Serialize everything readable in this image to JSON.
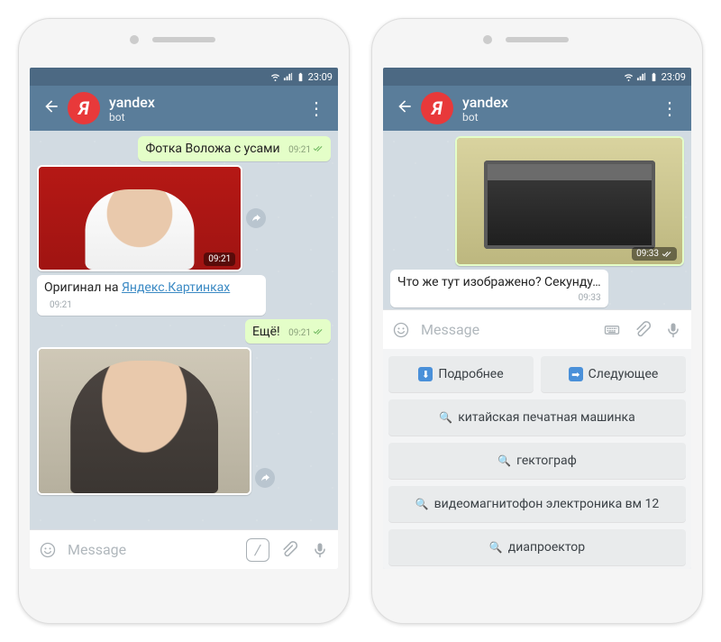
{
  "status": {
    "time": "23:09"
  },
  "header": {
    "contact_name": "yandex",
    "contact_sub": "bot",
    "avatar_letter": "Я"
  },
  "input": {
    "placeholder": "Message"
  },
  "left": {
    "msg1": {
      "text": "Фотка Воложа с усами",
      "time": "09:21"
    },
    "img1": {
      "time": "09:21"
    },
    "msg2": {
      "text_pre": "Оригинал на ",
      "link": "Яндекс.Картинках",
      "time": "09:21"
    },
    "msg3": {
      "text": "Ещё!",
      "time": "09:21"
    },
    "img2": {
      "time": ""
    }
  },
  "right": {
    "img1": {
      "time": "09:33"
    },
    "msg1": {
      "text": "Что же тут изображено? Секунду…",
      "time": "09:33"
    },
    "kb": {
      "b1": "Подробнее",
      "b2": "Следующее",
      "b3": "китайская печатная машинка",
      "b4": "гектограф",
      "b5": "видеомагнитофон электроника вм 12",
      "b6": "диапроектор"
    }
  }
}
